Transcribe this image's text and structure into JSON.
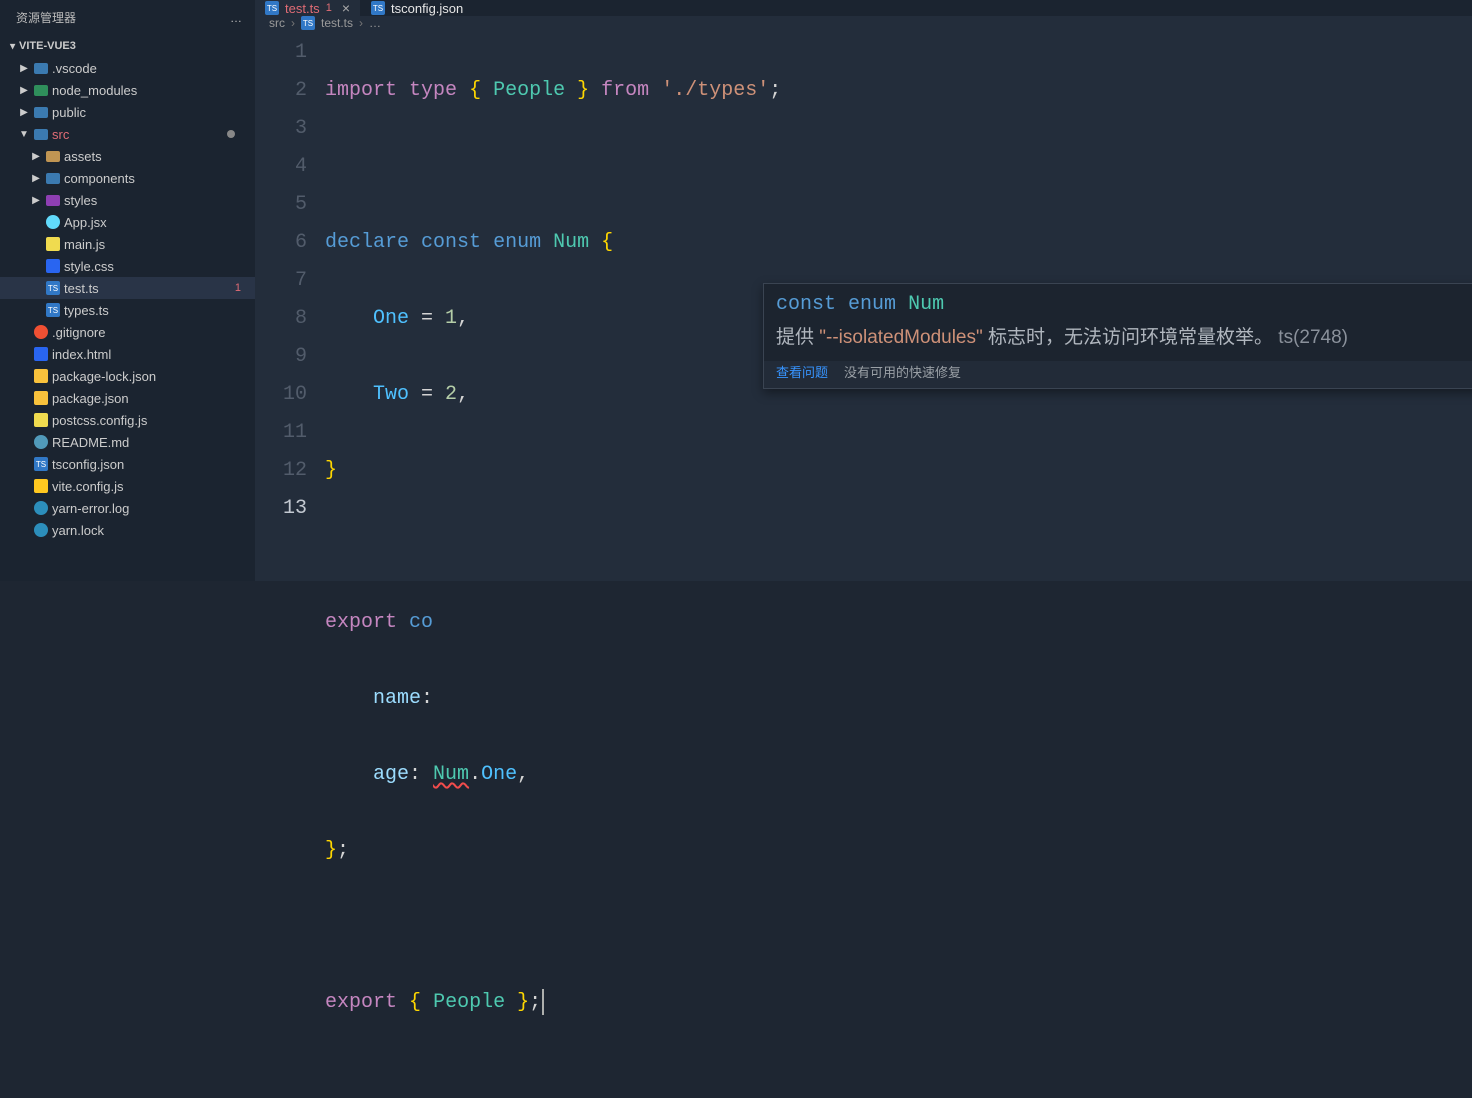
{
  "sidebar": {
    "title": "资源管理器",
    "more": "…",
    "project": "VITE-VUE3",
    "items": [
      {
        "label": ".vscode",
        "kind": "folder",
        "icon": "fi-folder",
        "depth": 1,
        "chev": "▶"
      },
      {
        "label": "node_modules",
        "kind": "folder",
        "icon": "fi-folder-g",
        "depth": 1,
        "chev": "▶"
      },
      {
        "label": "public",
        "kind": "folder",
        "icon": "fi-folder",
        "depth": 1,
        "chev": "▶"
      },
      {
        "label": "src",
        "kind": "folder-open",
        "icon": "fi-folder-o",
        "depth": 1,
        "chev": "▼",
        "active_folder": true,
        "dot": true
      },
      {
        "label": "assets",
        "kind": "folder",
        "icon": "fi-assets",
        "depth": 2,
        "chev": "▶"
      },
      {
        "label": "components",
        "kind": "folder",
        "icon": "fi-comp",
        "depth": 2,
        "chev": "▶"
      },
      {
        "label": "styles",
        "kind": "folder",
        "icon": "fi-styles",
        "depth": 2,
        "chev": "▶"
      },
      {
        "label": "App.jsx",
        "kind": "file",
        "icon": "fi-jsx",
        "depth": 2
      },
      {
        "label": "main.js",
        "kind": "file",
        "icon": "fi-js",
        "depth": 2
      },
      {
        "label": "style.css",
        "kind": "file",
        "icon": "fi-css",
        "depth": 2
      },
      {
        "label": "test.ts",
        "kind": "file",
        "icon": "fi-ts",
        "depth": 2,
        "active": true,
        "badge": "1"
      },
      {
        "label": "types.ts",
        "kind": "file",
        "icon": "fi-ts",
        "depth": 2
      },
      {
        "label": ".gitignore",
        "kind": "file",
        "icon": "fi-git",
        "depth": 1
      },
      {
        "label": "index.html",
        "kind": "file",
        "icon": "fi-css",
        "depth": 1
      },
      {
        "label": "package-lock.json",
        "kind": "file",
        "icon": "fi-json",
        "depth": 1
      },
      {
        "label": "package.json",
        "kind": "file",
        "icon": "fi-json",
        "depth": 1
      },
      {
        "label": "postcss.config.js",
        "kind": "file",
        "icon": "fi-js",
        "depth": 1
      },
      {
        "label": "README.md",
        "kind": "file",
        "icon": "fi-md",
        "depth": 1
      },
      {
        "label": "tsconfig.json",
        "kind": "file",
        "icon": "fi-ts",
        "depth": 1
      },
      {
        "label": "vite.config.js",
        "kind": "file",
        "icon": "fi-vite",
        "depth": 1
      },
      {
        "label": "yarn-error.log",
        "kind": "file",
        "icon": "fi-yarn",
        "depth": 1
      },
      {
        "label": "yarn.lock",
        "kind": "file",
        "icon": "fi-yarn",
        "depth": 1
      }
    ]
  },
  "tabs": [
    {
      "label": "test.ts",
      "icon": "fi-ts",
      "active": true,
      "modified": true,
      "dirty_badge": "1"
    },
    {
      "label": "tsconfig.json",
      "icon": "fi-ts",
      "active": false
    }
  ],
  "breadcrumbs": {
    "seg1": "src",
    "seg2": "test.ts",
    "seg3": "…"
  },
  "code": {
    "lines": [
      "1",
      "2",
      "3",
      "4",
      "5",
      "6",
      "7",
      "8",
      "9",
      "10",
      "11",
      "12",
      "13"
    ],
    "current_line": "13",
    "tokens": {
      "l1_import": "import",
      "l1_type": "type",
      "l1_ob": "{",
      "l1_people": "People",
      "l1_cb": "}",
      "l1_from": "from",
      "l1_str": "'./types'",
      "l1_semi": ";",
      "l3_declare": "declare",
      "l3_const": "const",
      "l3_enum": "enum",
      "l3_num": "Num",
      "l3_ob": "{",
      "l4_one": "One",
      "l4_eq": " = ",
      "l4_1": "1",
      "l4_c": ",",
      "l5_two": "Two",
      "l5_eq": " = ",
      "l5_2": "2",
      "l5_c": ",",
      "l6_cb": "}",
      "l8_export": "export",
      "l8_co": "co",
      "l9_name": "name",
      "l9_colon": ":",
      "l10_age": "age",
      "l10_colon": ": ",
      "l10_num": "Num",
      "l10_dot": ".",
      "l10_one": "One",
      "l10_c": ",",
      "l11_cb": "}",
      "l11_semi": ";",
      "l13_export": "export",
      "l13_ob": "{",
      "l13_people": "People",
      "l13_cb": "}",
      "l13_semi": ";"
    }
  },
  "hover": {
    "sig_const": "const",
    "sig_enum": "enum",
    "sig_num": "Num",
    "msg_pre": "提供 ",
    "msg_flag": "\"--isolatedModules\"",
    "msg_post": " 标志时，无法访问环境常量枚举。 ",
    "msg_code": "ts(2748)",
    "action_view": "查看问题",
    "action_nofix": "没有可用的快速修复"
  }
}
